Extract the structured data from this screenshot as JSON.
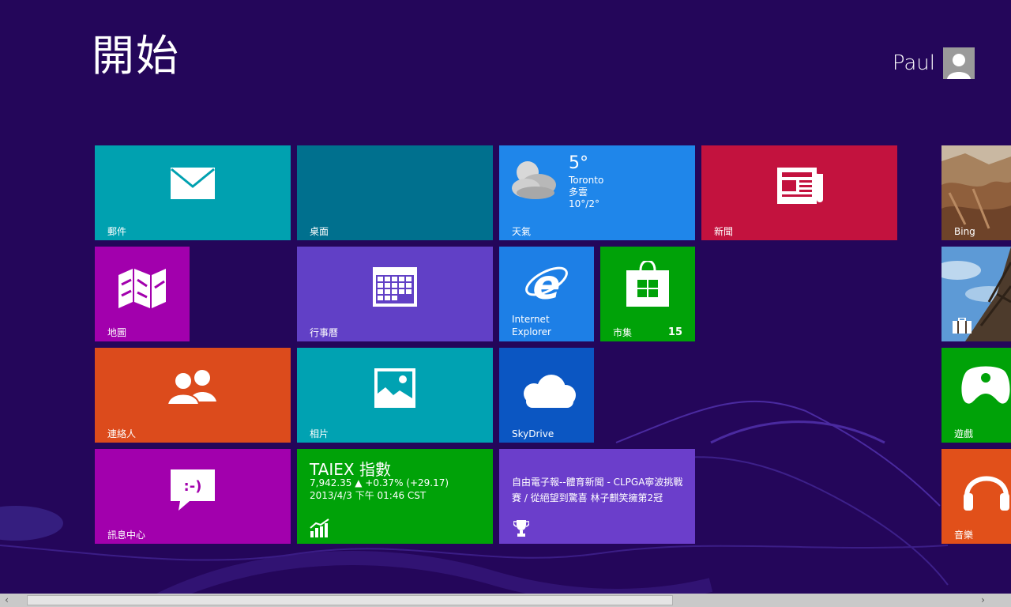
{
  "start": {
    "title": "開始"
  },
  "user": {
    "name": "Paul"
  },
  "tiles": {
    "mail": {
      "label": "郵件",
      "color": "#00a1b0"
    },
    "desktop": {
      "label": "桌面",
      "color": "#00708e"
    },
    "weather": {
      "label": "天氣",
      "temp": "5°",
      "city": "Toronto",
      "condition": "多雲",
      "range": "10°/2°",
      "color": "#1f86ea"
    },
    "news": {
      "label": "新聞",
      "color": "#c3123e"
    },
    "maps": {
      "label": "地圖",
      "color": "#a200ad"
    },
    "calendar": {
      "label": "行事曆",
      "color": "#6140c6"
    },
    "ie": {
      "label_line1": "Internet",
      "label_line2": "Explorer",
      "color": "#1d7fe6"
    },
    "store": {
      "label": "市集",
      "badge": "15",
      "color": "#00a208"
    },
    "people": {
      "label": "連絡人",
      "color": "#dc4b1c"
    },
    "photos": {
      "label": "相片",
      "color": "#00a2b2"
    },
    "skydrive": {
      "label": "SkyDrive",
      "color": "#0b56c2"
    },
    "messaging": {
      "label": "訊息中心",
      "color": "#a200ad"
    },
    "finance": {
      "title": "TAIEX 指數",
      "value": "7,942.35  ▲ +0.37% (+29.17)",
      "time": "2013/4/3 下午 01:46 CST",
      "color": "#00a208"
    },
    "sports": {
      "headline": "自由電子報--體育新聞 - CLPGA寧波挑戰賽 / 從絕望到驚喜 林子麒笑擁第2冠",
      "color": "#6b3ecb"
    },
    "bing": {
      "label": "Bing"
    },
    "travel": {
      "label": ""
    },
    "games": {
      "label": "遊戲",
      "color": "#00a208"
    },
    "music": {
      "label": "音樂",
      "color": "#e1501a"
    }
  },
  "scrollbar": {
    "left_arrow": "‹",
    "right_arrow": "›"
  }
}
